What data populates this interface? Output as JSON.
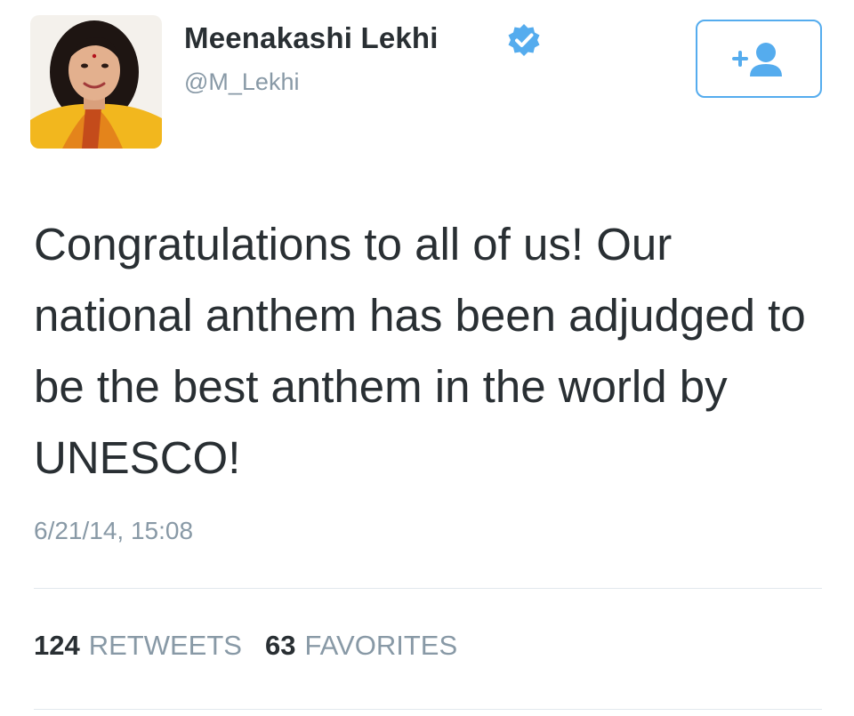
{
  "tweet": {
    "author": {
      "display_name": "Meenakashi Lekhi",
      "handle": "@M_Lekhi",
      "verified": true
    },
    "text": "Congratulations to all of us! Our national anthem has been adjudged to be the best anthem in the world by UNESCO!",
    "timestamp": "6/21/14, 15:08",
    "stats": {
      "retweets_count": "124",
      "retweets_label": "RETWEETS",
      "favorites_count": "63",
      "favorites_label": "FAVORITES"
    }
  },
  "icons": {
    "verified": "verified-badge-icon",
    "follow": "add-user-icon"
  },
  "colors": {
    "accent": "#55acee",
    "text": "#292f33",
    "muted": "#8899a6",
    "divider": "#e1e8ed"
  }
}
